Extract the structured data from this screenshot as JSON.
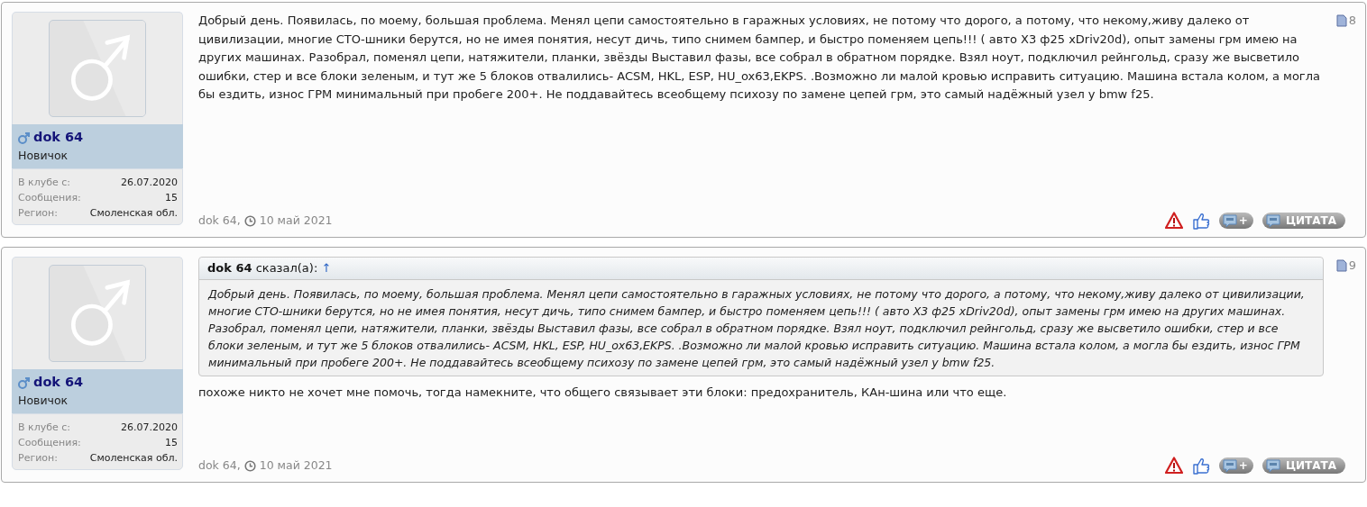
{
  "posts": [
    {
      "user": {
        "name": "dok 64",
        "title": "Новичок",
        "stats": [
          {
            "label": "В клубе с:",
            "value": "26.07.2020"
          },
          {
            "label": "Сообщения:",
            "value": "15"
          },
          {
            "label": "Регион:",
            "value": "Смоленская обл."
          }
        ]
      },
      "number": "8",
      "message": "Добрый день. Появилась, по моему, большая проблема. Менял цепи самостоятельно в гаражных условиях, не потому что дорого, а потому, что некому,живу далеко от цивилизации, многие СТО-шники берутся, но не имея понятия, несут дичь, типо снимем бампер, и быстро поменяем цепь!!! ( авто Х3 ф25 xDriv20d), опыт замены грм имею на других машинах. Разобрал, поменял цепи, натяжители, планки, звёзды Выставил фазы, все собрал в обратном порядке. Взял ноут, подключил рейнгольд, сразу же высветило ошибки, стер и все блоки зеленым, и тут же 5 блоков отвалились- ACSM, HKL, ESP, HU_ox63,EKPS. .Возможно ли малой кровью исправить ситуацию. Машина встала колом, а могла бы ездить, износ ГРМ минимальный при пробеге 200+. Не поддавайтесь всеобщему психозу по замене цепей грм, это самый надёжный узел у bmw f25.",
      "footer": {
        "author": "dok 64,",
        "date": "10 май 2021"
      },
      "actions": {
        "multiquote": "+",
        "quote": "ЦИТАТА"
      }
    },
    {
      "user": {
        "name": "dok 64",
        "title": "Новичок",
        "stats": [
          {
            "label": "В клубе с:",
            "value": "26.07.2020"
          },
          {
            "label": "Сообщения:",
            "value": "15"
          },
          {
            "label": "Регион:",
            "value": "Смоленская обл."
          }
        ]
      },
      "number": "9",
      "quote": {
        "author": "dok 64",
        "said": "сказал(а):",
        "arrow": "↑",
        "text": "Добрый день. Появилась, по моему, большая проблема. Менял цепи самостоятельно в гаражных условиях, не потому что дорого, а потому, что некому,живу далеко от цивилизации, многие СТО-шники берутся, но не имея понятия, несут дичь, типо снимем бампер, и быстро поменяем цепь!!! ( авто Х3 ф25 xDriv20d), опыт замены грм имею на других машинах. Разобрал, поменял цепи, натяжители, планки, звёзды Выставил фазы, все собрал в обратном порядке. Взял ноут, подключил рейнгольд, сразу же высветило ошибки, стер и все блоки зеленым, и тут же 5 блоков отвалились- ACSM, HKL, ESP, HU_ox63,EKPS. .Возможно ли малой кровью исправить ситуацию. Машина встала колом, а могла бы ездить, износ ГРМ минимальный при пробеге 200+. Не поддавайтесь всеобщему психозу по замене цепей грм, это самый надёжный узел у bmw f25."
      },
      "message": "похоже никто не хочет мне помочь, тогда намекните, что общего связывает эти блоки: предохранитель, КАн-шина или что еще.",
      "footer": {
        "author": "dok 64,",
        "date": "10 май 2021"
      },
      "actions": {
        "multiquote": "+",
        "quote": "ЦИТАТА"
      }
    }
  ]
}
